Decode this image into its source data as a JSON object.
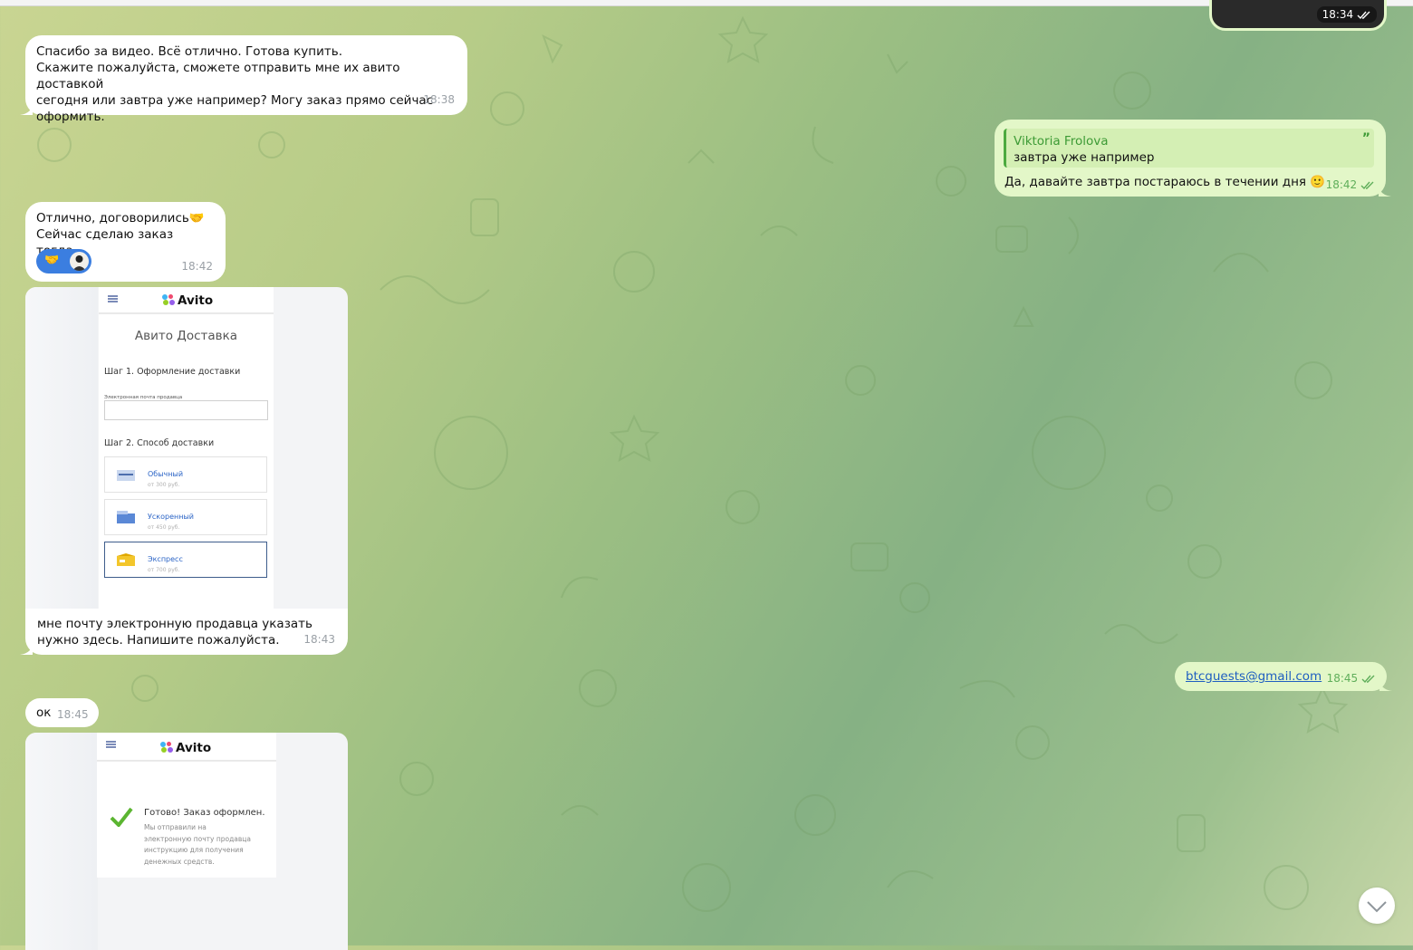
{
  "messages": {
    "m1": {
      "text": "Спасибо за видео. Всё отлично. Готова купить.\nСкажите пожалуйста, сможете отправить мне их авито доставкой\nсегодня или завтра уже например? Могу заказ прямо сейчас\nоформить.",
      "time": "18:38"
    },
    "m_top_out": {
      "time": "18:34"
    },
    "m2_out": {
      "reply_author": "Viktoria Frolova",
      "reply_text": "завтра уже например",
      "text": "Да, давайте завтра постараюсь в течении дня 🙂",
      "time": "18:42"
    },
    "m3": {
      "text": "Отлично, договорились🤝\nСейчас сделаю заказ тогда.",
      "time": "18:42",
      "reaction": "🤝"
    },
    "m4": {
      "caption": "мне почту электронную продавца указать\nнужно здесь. Напишите пожалуйста.",
      "time": "18:43"
    },
    "m5_out": {
      "text": "btcguests@gmail.com",
      "time": "18:45"
    },
    "m6": {
      "text": "ок",
      "time": "18:45"
    }
  },
  "avito1": {
    "logo": "Avito",
    "title": "Авито Доставка",
    "step1": "Шаг 1. Оформление доставки",
    "email_label": "Электронная почта продавца",
    "step2": "Шаг 2. Способ доставки",
    "options": [
      {
        "name": "Обычный",
        "price": "от 300 руб."
      },
      {
        "name": "Ускоренный",
        "price": "от 450 руб."
      },
      {
        "name": "Экспресс",
        "price": "от 700 руб."
      }
    ]
  },
  "avito2": {
    "logo": "Avito",
    "done_title": "Готово! Заказ оформлен.",
    "done_text": "Мы отправили на\nэлектронную почту продавца\nинструкцию для получения\nденежных средств."
  },
  "icons": [
    "double-check-icon",
    "quote-icon",
    "burger-menu-icon",
    "checkmark-icon",
    "chevron-down-icon"
  ],
  "colors": {
    "outgoing_bubble": "#e3f7c8",
    "incoming_bubble": "#ffffff",
    "accent_green": "#5fae5a",
    "link_blue": "#2b64c6"
  }
}
